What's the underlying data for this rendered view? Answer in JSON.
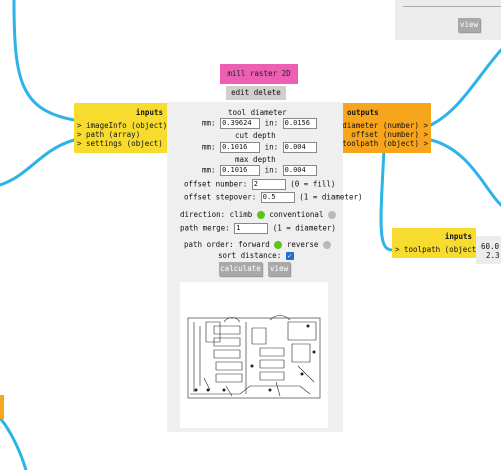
{
  "top_right": {
    "view_label": "view"
  },
  "module": {
    "title": "mill raster 2D",
    "edit_delete": "edit delete",
    "tool_diameter": {
      "label": "tool diameter",
      "mm_label": "mm:",
      "mm": "0.39624",
      "in_label": "in:",
      "in": "0.0156"
    },
    "cut_depth": {
      "label": "cut depth",
      "mm_label": "mm:",
      "mm": "0.1016",
      "in_label": "in:",
      "in": "0.004"
    },
    "max_depth": {
      "label": "max depth",
      "mm_label": "mm:",
      "mm": "0.1016",
      "in_label": "in:",
      "in": "0.004"
    },
    "offset_number": {
      "label": "offset number:",
      "value": "2",
      "hint": "(0 = fill)"
    },
    "offset_stepover": {
      "label": "offset stepover:",
      "value": "0.5",
      "hint": "(1 = diameter)"
    },
    "direction": {
      "label": "direction: climb",
      "alt": "conventional"
    },
    "path_merge": {
      "label": "path merge:",
      "value": "1",
      "hint": "(1 = diameter)"
    },
    "path_order": {
      "label": "path order: forward",
      "alt": "reverse"
    },
    "sort_distance": {
      "label": "sort distance:",
      "check": "✓"
    },
    "calculate_label": "calculate",
    "view_label": "view"
  },
  "inputs": {
    "title": "inputs",
    "items": [
      "> imageInfo (object)",
      "> path (array)",
      "> settings (object)"
    ]
  },
  "outputs": {
    "title": "outputs",
    "items": [
      "diameter (number) >",
      "offset (number) >",
      "toolpath (object) >"
    ]
  },
  "inputs2": {
    "title": "inputs",
    "items": [
      "> toolpath (object)"
    ]
  },
  "side_values": [
    "60.0",
    "2.3"
  ],
  "colors": {
    "wire": "#2db3ea",
    "inputs": "#f7dc2f",
    "outputs": "#f8a51e",
    "title": "#ec5fb3",
    "radio_on": "#5fc21b",
    "radio_off": "#b9b9b9"
  }
}
